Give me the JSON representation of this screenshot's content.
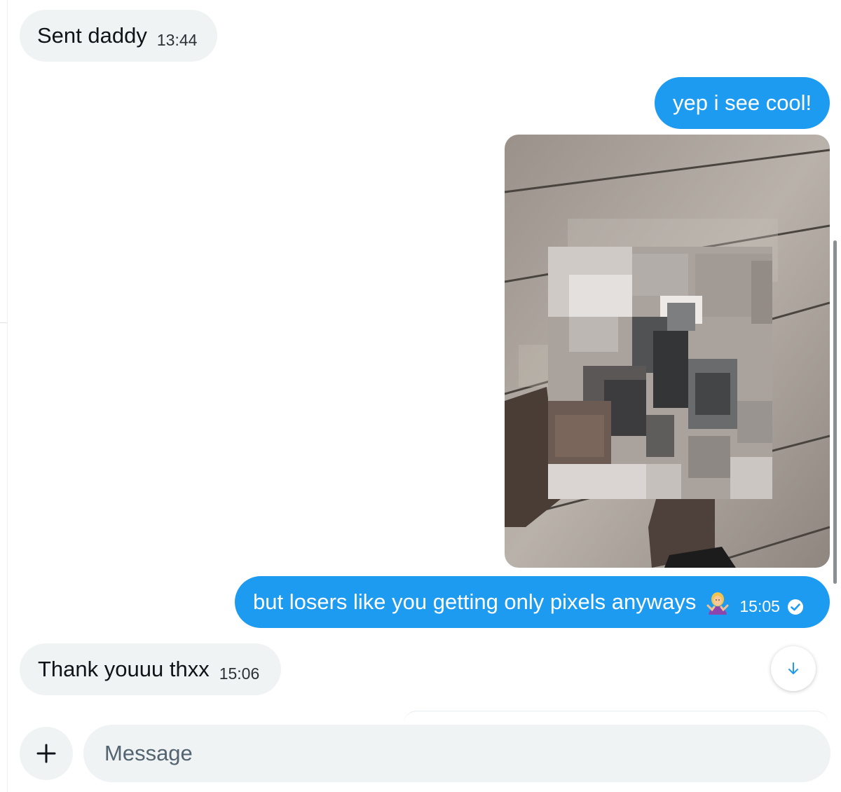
{
  "colors": {
    "incoming_bubble": "#eff3f4",
    "outgoing_bubble": "#1d9bf0",
    "accent": "#1d9bf0",
    "text": "#0f1419",
    "muted": "#536471"
  },
  "messages": [
    {
      "direction": "incoming",
      "text": "Sent daddy",
      "time": "13:44"
    },
    {
      "direction": "outgoing",
      "text": "yep i see cool!"
    },
    {
      "direction": "outgoing",
      "media": "pixelated-photo"
    },
    {
      "direction": "outgoing",
      "text": "but losers like you getting only pixels anyways",
      "emoji": "person-shrugging",
      "time": "15:05",
      "status_icon": "read-check-icon"
    },
    {
      "direction": "incoming",
      "text": "Thank youuu thxx",
      "time": "15:06"
    }
  ],
  "scroll_button_icon": "arrow-down-icon",
  "composer": {
    "add_icon": "plus-icon",
    "placeholder": "Message",
    "value": ""
  }
}
